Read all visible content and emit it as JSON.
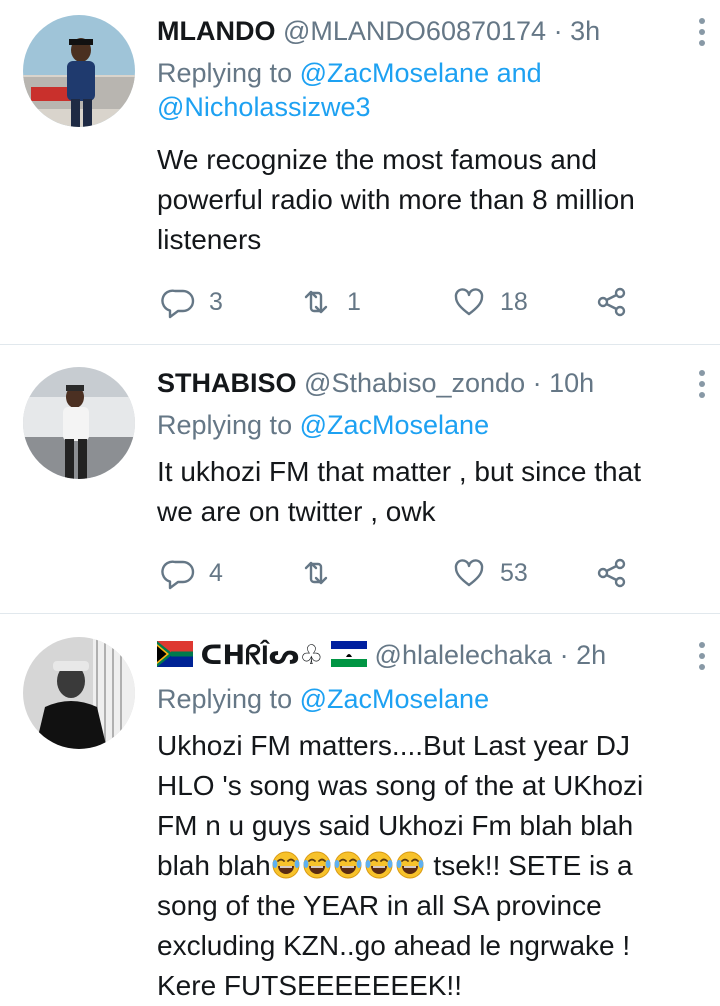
{
  "tweets": [
    {
      "name": "MLANDO",
      "handle": "@MLANDO60870174",
      "time": "· 3h",
      "replying_prefix": "Replying to ",
      "replying_to_1": "@ZacMoselane",
      "replying_and": " and",
      "replying_to_2": "@Nicholassizwe3",
      "text_lines": [
        "We recognize the most famous and",
        "powerful radio with more than 8 million",
        "listeners"
      ],
      "replies": "3",
      "retweets": "1",
      "likes": "18"
    },
    {
      "name": "STHABISO",
      "handle": "@Sthabiso_zondo",
      "time": "· 10h",
      "replying_prefix": "Replying to ",
      "replying_to_1": "@ZacMoselane",
      "text_lines": [
        "It ukhozi FM that matter , but since that",
        "we are on twitter  , owk"
      ],
      "replies": "4",
      "retweets": "",
      "likes": "53"
    },
    {
      "name": "ᑕᕼᖇÎᔕ♧",
      "handle": "@hlalelechaka",
      "time": "· 2h",
      "replying_prefix": "Replying to ",
      "replying_to_1": "@ZacMoselane",
      "text_lines": [
        "Ukhozi FM matters....But Last year DJ",
        "HLO 's song was song of the at UKhozi",
        "FM n u guys said Ukhozi Fm blah blah",
        "blah blah",
        " tsek!! SETE is a",
        "song of the YEAR in all SA province",
        "excluding KZN..go ahead le ngrwake !",
        "Kere FUTSEEEEEEEK!!"
      ],
      "emoji_name": "face-with-tears-of-joy-icon",
      "emoji_count": 5
    }
  ],
  "colors": {
    "link": "#1da1f2",
    "muted": "#657786",
    "text": "#14171a",
    "divider": "#e1e8ed"
  },
  "icons": [
    "reply-icon",
    "retweet-icon",
    "like-icon",
    "share-icon",
    "more-options-icon",
    "south-africa-flag-icon",
    "lesotho-flag-icon"
  ]
}
